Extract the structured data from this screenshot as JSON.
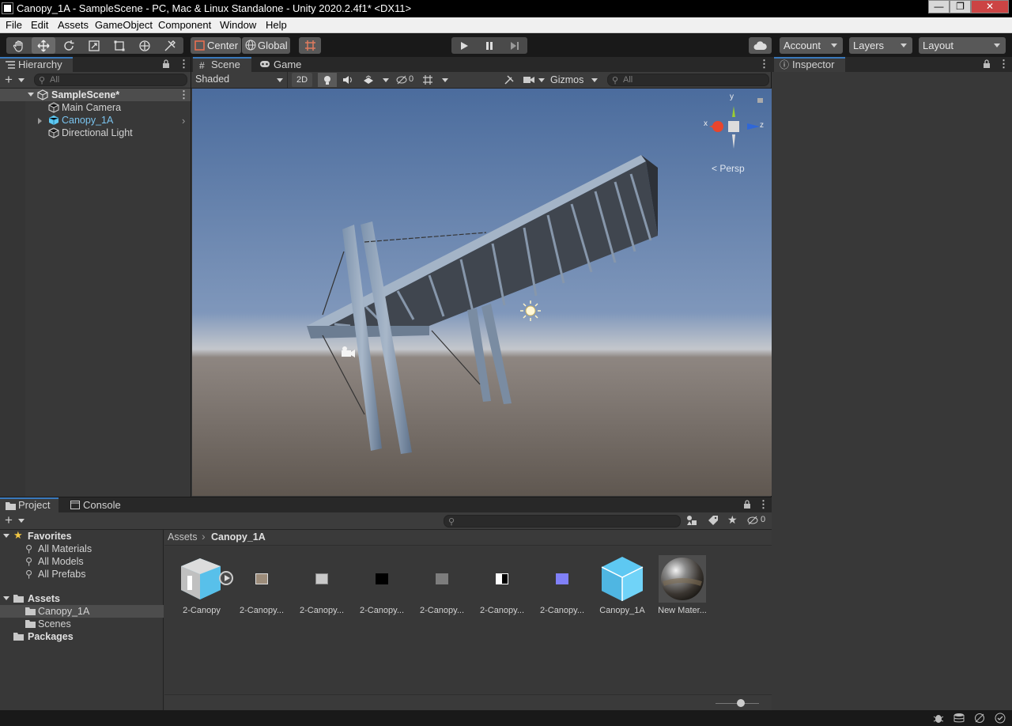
{
  "window": {
    "title": "Canopy_1A - SampleScene - PC, Mac & Linux Standalone - Unity 2020.2.4f1* <DX11>",
    "minimize": "—",
    "restore": "❐",
    "close": "✕"
  },
  "menu": [
    "File",
    "Edit",
    "Assets",
    "GameObject",
    "Component",
    "Window",
    "Help"
  ],
  "toolbar": {
    "pivot_label": "Center",
    "space_label": "Global",
    "account_label": "Account",
    "layers_label": "Layers",
    "layout_label": "Layout"
  },
  "hierarchy": {
    "tab_label": "Hierarchy",
    "add": "+",
    "search_placeholder": "All",
    "scene_name": "SampleScene*",
    "items": [
      "Main Camera",
      "Canopy_1A",
      "Directional Light"
    ]
  },
  "scene": {
    "tab_scene": "Scene",
    "tab_game": "Game",
    "draw_mode": "Shaded",
    "btn_2d": "2D",
    "hidden_count": "0",
    "gizmos_label": "Gizmos",
    "search_placeholder": "All",
    "persp_label": "Persp",
    "axis_x": "x",
    "axis_y": "y",
    "axis_z": "z"
  },
  "inspector": {
    "tab_label": "Inspector"
  },
  "project": {
    "tab_project": "Project",
    "tab_console": "Console",
    "add": "+",
    "hidden_count": "0",
    "breadcrumb_root": "Assets",
    "breadcrumb_current": "Canopy_1A",
    "favorites_label": "Favorites",
    "favorites": [
      "All Materials",
      "All Models",
      "All Prefabs"
    ],
    "assets_label": "Assets",
    "asset_folders": [
      "Canopy_1A",
      "Scenes"
    ],
    "packages_label": "Packages",
    "assets": [
      {
        "name": "2-Canopy",
        "kind": "model"
      },
      {
        "name": "2-Canopy...",
        "kind": "texture-brown"
      },
      {
        "name": "2-Canopy...",
        "kind": "texture-grey-speckle"
      },
      {
        "name": "2-Canopy...",
        "kind": "texture-black"
      },
      {
        "name": "2-Canopy...",
        "kind": "texture-grey"
      },
      {
        "name": "2-Canopy...",
        "kind": "texture-bw"
      },
      {
        "name": "2-Canopy...",
        "kind": "texture-normal"
      },
      {
        "name": "Canopy_1A",
        "kind": "prefab"
      },
      {
        "name": "New Mater...",
        "kind": "material"
      }
    ]
  },
  "colors": {
    "accent_blue": "#3a79bb",
    "prefab_blue": "#5ec8f2",
    "sky_top": "#5d7fae",
    "ground": "#6b625c"
  }
}
